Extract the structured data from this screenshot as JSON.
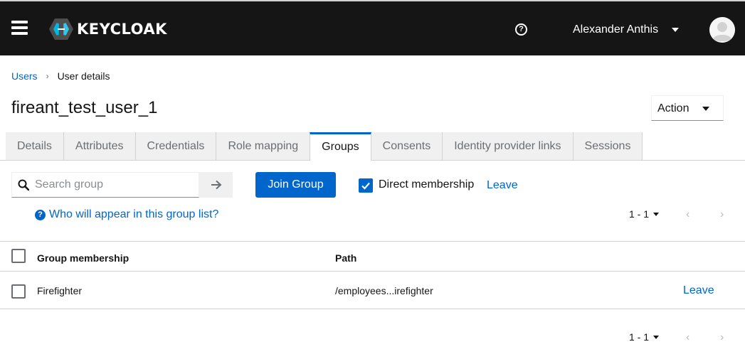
{
  "header": {
    "brand": "KEYCLOAK",
    "username": "Alexander Anthis"
  },
  "breadcrumb": {
    "parent": "Users",
    "current": "User details"
  },
  "page": {
    "title": "fireant_test_user_1",
    "action_label": "Action"
  },
  "tabs": [
    {
      "label": "Details"
    },
    {
      "label": "Attributes"
    },
    {
      "label": "Credentials"
    },
    {
      "label": "Role mapping"
    },
    {
      "label": "Groups"
    },
    {
      "label": "Consents"
    },
    {
      "label": "Identity provider links"
    },
    {
      "label": "Sessions"
    }
  ],
  "toolbar": {
    "search_placeholder": "Search group",
    "join_label": "Join Group",
    "direct_membership_label": "Direct membership",
    "direct_membership_checked": true,
    "leave_label": "Leave",
    "help_link": "Who will appear in this group list?"
  },
  "pagination": {
    "top_count": "1 - 1",
    "bottom_count": "1 - 1"
  },
  "table": {
    "headers": {
      "name": "Group membership",
      "path": "Path"
    },
    "rows": [
      {
        "name": "Firefighter",
        "path": "/employees...irefighter",
        "action": "Leave"
      }
    ]
  },
  "colors": {
    "topbar": "#151515",
    "accent": "#0066cc"
  }
}
